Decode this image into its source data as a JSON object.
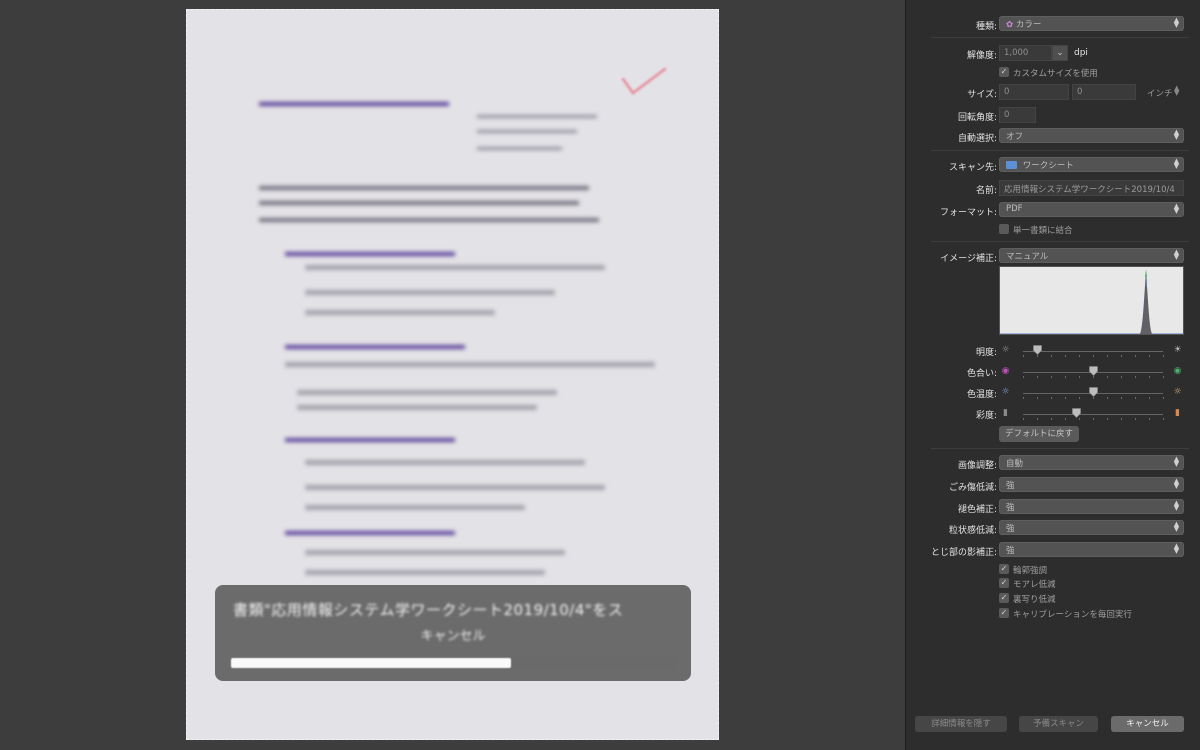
{
  "progress": {
    "message": "書類\"応用情報システム学ワークシート2019/10/4\"をス",
    "cancel_label": "キャンセル",
    "fraction": 0.63
  },
  "settings": {
    "kind": {
      "label": "種類:",
      "value": "カラー",
      "icon": "color-palette-icon"
    },
    "resolution": {
      "label": "解像度:",
      "value": "1,000",
      "unit": "dpi"
    },
    "custom_size": {
      "label": "カスタムサイズを使用",
      "checked": true
    },
    "size": {
      "label": "サイズ:",
      "width": "0",
      "height": "0",
      "unit": "インチ"
    },
    "rotation": {
      "label": "回転角度:",
      "value": "0"
    },
    "auto_select": {
      "label": "自動選択:",
      "value": "オフ"
    },
    "scan_to": {
      "label": "スキャン先:",
      "value": "ワークシート",
      "icon": "folder-icon"
    },
    "name": {
      "label": "名前:",
      "value": "応用情報システム学ワークシート2019/10/4"
    },
    "format": {
      "label": "フォーマット:",
      "value": "PDF"
    },
    "combine": {
      "label": "単一書類に結合",
      "checked": false
    },
    "image_correction": {
      "label": "イメージ補正:",
      "value": "マニュアル"
    },
    "sliders": [
      {
        "label": "明度:",
        "value": 0.1,
        "left_icon": "sun-small-icon",
        "right_icon": "sun-large-icon"
      },
      {
        "label": "色合い:",
        "value": 0.5,
        "left_icon": "magenta-dot-icon",
        "right_icon": "green-dot-icon"
      },
      {
        "label": "色温度:",
        "value": 0.5,
        "left_icon": "cool-sun-icon",
        "right_icon": "warm-sun-icon"
      },
      {
        "label": "彩度:",
        "value": 0.38,
        "left_icon": "gray-swatch-icon",
        "right_icon": "color-swatch-icon"
      }
    ],
    "reset_label": "デフォルトに戻す",
    "image_adjust": {
      "label": "画像調整:",
      "value": "自動"
    },
    "dust": {
      "label": "ごみ傷低減:",
      "value": "強"
    },
    "fade": {
      "label": "褪色補正:",
      "value": "強"
    },
    "grain": {
      "label": "粒状感低減:",
      "value": "強"
    },
    "gutter": {
      "label": "とじ部の影補正:",
      "value": "強"
    },
    "checkboxes": [
      {
        "label": "輪郭強調",
        "checked": true
      },
      {
        "label": "モアレ低減",
        "checked": true
      },
      {
        "label": "裏写り低減",
        "checked": true
      },
      {
        "label": "キャリブレーションを毎回実行",
        "checked": true
      }
    ]
  },
  "footer": {
    "hide_details": "詳細情報を隠す",
    "overview": "予備スキャン",
    "cancel": "キャンセル"
  },
  "colors": {
    "panel_bg": "#2d2d2d",
    "preview_bg": "#3d3d3d",
    "check_mark": "#e88a9a",
    "folder": "#5b8fd6"
  }
}
